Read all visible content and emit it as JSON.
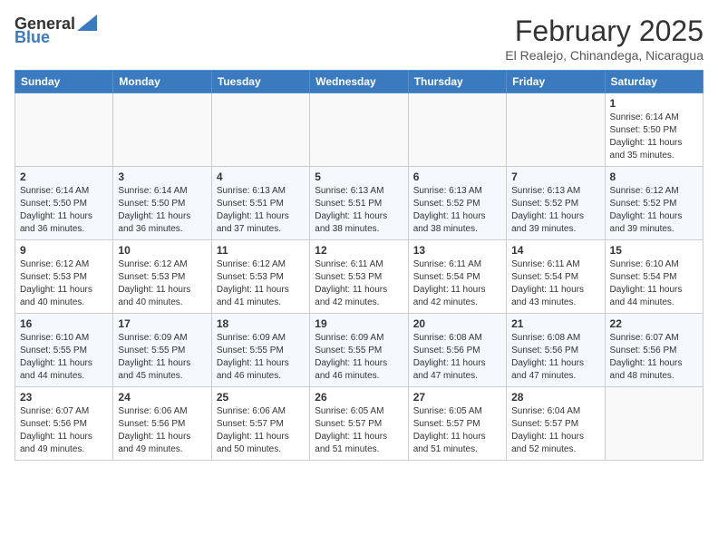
{
  "header": {
    "logo_general": "General",
    "logo_blue": "Blue",
    "month_title": "February 2025",
    "location": "El Realejo, Chinandega, Nicaragua"
  },
  "weekdays": [
    "Sunday",
    "Monday",
    "Tuesday",
    "Wednesday",
    "Thursday",
    "Friday",
    "Saturday"
  ],
  "weeks": [
    [
      {
        "day": "",
        "info": ""
      },
      {
        "day": "",
        "info": ""
      },
      {
        "day": "",
        "info": ""
      },
      {
        "day": "",
        "info": ""
      },
      {
        "day": "",
        "info": ""
      },
      {
        "day": "",
        "info": ""
      },
      {
        "day": "1",
        "info": "Sunrise: 6:14 AM\nSunset: 5:50 PM\nDaylight: 11 hours\nand 35 minutes."
      }
    ],
    [
      {
        "day": "2",
        "info": "Sunrise: 6:14 AM\nSunset: 5:50 PM\nDaylight: 11 hours\nand 36 minutes."
      },
      {
        "day": "3",
        "info": "Sunrise: 6:14 AM\nSunset: 5:50 PM\nDaylight: 11 hours\nand 36 minutes."
      },
      {
        "day": "4",
        "info": "Sunrise: 6:13 AM\nSunset: 5:51 PM\nDaylight: 11 hours\nand 37 minutes."
      },
      {
        "day": "5",
        "info": "Sunrise: 6:13 AM\nSunset: 5:51 PM\nDaylight: 11 hours\nand 38 minutes."
      },
      {
        "day": "6",
        "info": "Sunrise: 6:13 AM\nSunset: 5:52 PM\nDaylight: 11 hours\nand 38 minutes."
      },
      {
        "day": "7",
        "info": "Sunrise: 6:13 AM\nSunset: 5:52 PM\nDaylight: 11 hours\nand 39 minutes."
      },
      {
        "day": "8",
        "info": "Sunrise: 6:12 AM\nSunset: 5:52 PM\nDaylight: 11 hours\nand 39 minutes."
      }
    ],
    [
      {
        "day": "9",
        "info": "Sunrise: 6:12 AM\nSunset: 5:53 PM\nDaylight: 11 hours\nand 40 minutes."
      },
      {
        "day": "10",
        "info": "Sunrise: 6:12 AM\nSunset: 5:53 PM\nDaylight: 11 hours\nand 40 minutes."
      },
      {
        "day": "11",
        "info": "Sunrise: 6:12 AM\nSunset: 5:53 PM\nDaylight: 11 hours\nand 41 minutes."
      },
      {
        "day": "12",
        "info": "Sunrise: 6:11 AM\nSunset: 5:53 PM\nDaylight: 11 hours\nand 42 minutes."
      },
      {
        "day": "13",
        "info": "Sunrise: 6:11 AM\nSunset: 5:54 PM\nDaylight: 11 hours\nand 42 minutes."
      },
      {
        "day": "14",
        "info": "Sunrise: 6:11 AM\nSunset: 5:54 PM\nDaylight: 11 hours\nand 43 minutes."
      },
      {
        "day": "15",
        "info": "Sunrise: 6:10 AM\nSunset: 5:54 PM\nDaylight: 11 hours\nand 44 minutes."
      }
    ],
    [
      {
        "day": "16",
        "info": "Sunrise: 6:10 AM\nSunset: 5:55 PM\nDaylight: 11 hours\nand 44 minutes."
      },
      {
        "day": "17",
        "info": "Sunrise: 6:09 AM\nSunset: 5:55 PM\nDaylight: 11 hours\nand 45 minutes."
      },
      {
        "day": "18",
        "info": "Sunrise: 6:09 AM\nSunset: 5:55 PM\nDaylight: 11 hours\nand 46 minutes."
      },
      {
        "day": "19",
        "info": "Sunrise: 6:09 AM\nSunset: 5:55 PM\nDaylight: 11 hours\nand 46 minutes."
      },
      {
        "day": "20",
        "info": "Sunrise: 6:08 AM\nSunset: 5:56 PM\nDaylight: 11 hours\nand 47 minutes."
      },
      {
        "day": "21",
        "info": "Sunrise: 6:08 AM\nSunset: 5:56 PM\nDaylight: 11 hours\nand 47 minutes."
      },
      {
        "day": "22",
        "info": "Sunrise: 6:07 AM\nSunset: 5:56 PM\nDaylight: 11 hours\nand 48 minutes."
      }
    ],
    [
      {
        "day": "23",
        "info": "Sunrise: 6:07 AM\nSunset: 5:56 PM\nDaylight: 11 hours\nand 49 minutes."
      },
      {
        "day": "24",
        "info": "Sunrise: 6:06 AM\nSunset: 5:56 PM\nDaylight: 11 hours\nand 49 minutes."
      },
      {
        "day": "25",
        "info": "Sunrise: 6:06 AM\nSunset: 5:57 PM\nDaylight: 11 hours\nand 50 minutes."
      },
      {
        "day": "26",
        "info": "Sunrise: 6:05 AM\nSunset: 5:57 PM\nDaylight: 11 hours\nand 51 minutes."
      },
      {
        "day": "27",
        "info": "Sunrise: 6:05 AM\nSunset: 5:57 PM\nDaylight: 11 hours\nand 51 minutes."
      },
      {
        "day": "28",
        "info": "Sunrise: 6:04 AM\nSunset: 5:57 PM\nDaylight: 11 hours\nand 52 minutes."
      },
      {
        "day": "",
        "info": ""
      }
    ]
  ]
}
